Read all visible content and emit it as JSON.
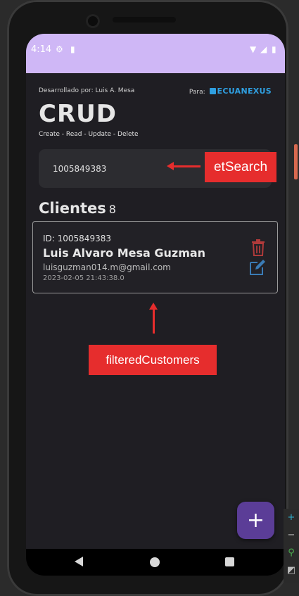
{
  "status_bar": {
    "time": "4:14",
    "bg_color": "#cfb7f6"
  },
  "header": {
    "developer": "Desarrollado por: Luis A. Mesa",
    "para_label": "Para:",
    "brand": "ECUANEXUS",
    "title": "CRUD",
    "subtitle": "Create - Read - Update - Delete"
  },
  "search": {
    "value": "1005849383",
    "annotation": "etSearch"
  },
  "clientes": {
    "title": "Clientes",
    "count": "8"
  },
  "customers": [
    {
      "id_text": "ID: 1005849383",
      "name": "Luis Alvaro Mesa Guzman",
      "email": "luisguzman014.m@gmail.com",
      "date": "2023-02-05 21:43:38.0"
    }
  ],
  "annotations": {
    "list_label": "filteredCustomers"
  },
  "fab": {
    "label": "+"
  },
  "colors": {
    "accent": "#5b3d97",
    "annotation_red": "#e62d2d",
    "delete_icon": "#b03a3a",
    "edit_icon": "#3a7bb5",
    "brand_blue": "#2f9fe0"
  }
}
